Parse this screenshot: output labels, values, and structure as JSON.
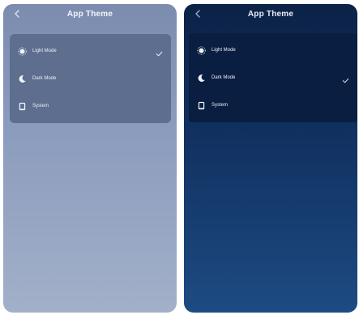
{
  "screens": [
    {
      "mode": "light",
      "title": "App Theme",
      "options": [
        {
          "label": "Light Mode",
          "icon": "sun-icon",
          "selected": true
        },
        {
          "label": "Dark Mode",
          "icon": "moon-icon",
          "selected": false
        },
        {
          "label": "System",
          "icon": "phone-icon",
          "selected": false
        }
      ]
    },
    {
      "mode": "dark",
      "title": "App Theme",
      "options": [
        {
          "label": "Light Mode",
          "icon": "sun-icon",
          "selected": false
        },
        {
          "label": "Dark Mode",
          "icon": "moon-icon",
          "selected": true
        },
        {
          "label": "System",
          "icon": "phone-icon",
          "selected": false
        }
      ]
    }
  ],
  "colors": {
    "light_bg": "#8d9dbd",
    "light_card": "#5e6e8f",
    "dark_bg": "#113262",
    "dark_card": "#091e40",
    "text": "#ffffff"
  }
}
